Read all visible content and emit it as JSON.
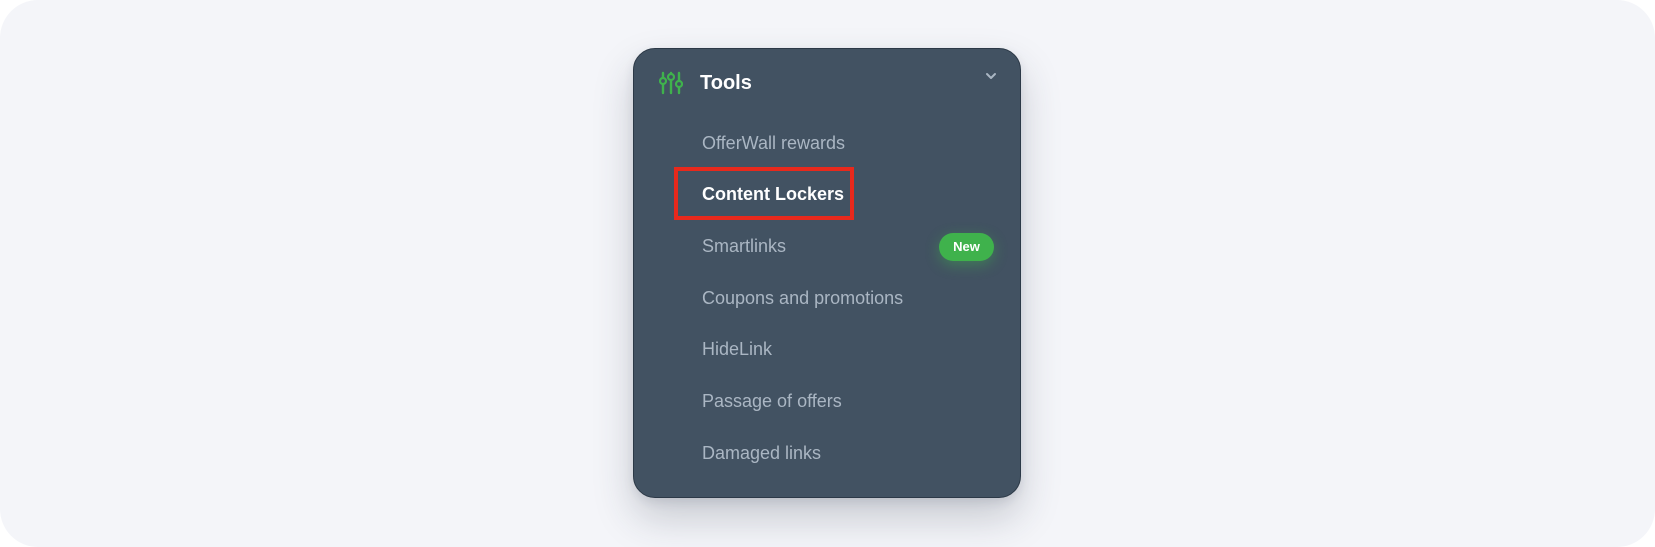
{
  "sidebar": {
    "section_title": "Tools",
    "section_icon": "sliders-icon",
    "accent_color": "#3fb24c",
    "items": [
      {
        "label": "OfferWall rewards",
        "active": false
      },
      {
        "label": "Content Lockers",
        "active": true
      },
      {
        "label": "Smartlinks",
        "active": false,
        "badge": "New"
      },
      {
        "label": "Coupons and promotions",
        "active": false
      },
      {
        "label": "HideLink",
        "active": false
      },
      {
        "label": "Passage of offers",
        "active": false
      },
      {
        "label": "Damaged links",
        "active": false
      }
    ]
  },
  "highlight_color": "#e8291c"
}
